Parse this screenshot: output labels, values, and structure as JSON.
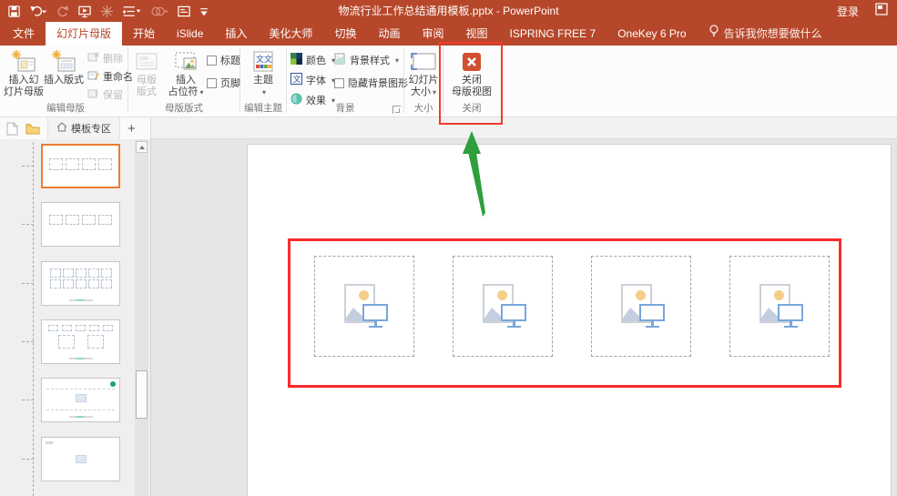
{
  "titlebar": {
    "title": "物流行业工作总结通用模板.pptx - PowerPoint",
    "login": "登录",
    "qat_icons": [
      "save-icon",
      "undo-icon",
      "redo-icon",
      "present-icon",
      "beautify-icon",
      "paragraph-icon",
      "shapes-icon",
      "new-doc-icon",
      "customize-qat-icon"
    ]
  },
  "tabs": [
    {
      "label": "文件"
    },
    {
      "label": "幻灯片母版",
      "active": true
    },
    {
      "label": "开始"
    },
    {
      "label": "iSlide"
    },
    {
      "label": "插入"
    },
    {
      "label": "美化大师"
    },
    {
      "label": "切换"
    },
    {
      "label": "动画"
    },
    {
      "label": "审阅"
    },
    {
      "label": "视图"
    },
    {
      "label": "ISPRING FREE 7"
    },
    {
      "label": "OneKey 6 Pro"
    }
  ],
  "tell_me": "告诉我你想要做什么",
  "ribbon": {
    "edit_master": {
      "label": "编辑母版",
      "insert_master_l1": "插入幻",
      "insert_master_l2": "灯片母版",
      "insert_layout": "插入版式",
      "delete": "删除",
      "rename": "重命名",
      "preserve": "保留"
    },
    "master_layout": {
      "label": "母版版式",
      "master_layout_l1": "母版",
      "master_layout_l2": "版式",
      "insert_placeholder_l1": "插入",
      "insert_placeholder_l2": "占位符",
      "title_cb": "标题",
      "footer_cb": "页脚"
    },
    "edit_theme": {
      "label": "编辑主题",
      "themes": "主题"
    },
    "background": {
      "label": "背景",
      "colors": "颜色",
      "fonts": "字体",
      "effects": "效果",
      "bg_styles": "背景样式",
      "hide_bg": "隐藏背景图形"
    },
    "size": {
      "label": "大小",
      "slide_size_l1": "幻灯片",
      "slide_size_l2": "大小"
    },
    "close": {
      "label": "关闭",
      "close_l1": "关闭",
      "close_l2": "母版视图"
    }
  },
  "panel": {
    "template_tab": "模板专区"
  },
  "thumbnails": [
    {
      "selected": true,
      "layout": "four-picture-placeholders"
    },
    {
      "selected": false,
      "layout": "four-pictures-with-captions"
    },
    {
      "selected": false,
      "layout": "ten-picture-grid"
    },
    {
      "selected": false,
      "layout": "five-plus-two-pictures"
    },
    {
      "selected": false,
      "layout": "lined-content-with-picture"
    },
    {
      "selected": false,
      "layout": "single-picture"
    }
  ],
  "main_slide": {
    "picture_placeholder_count": 4
  },
  "annotations": {
    "highlight_color": "#fb2b2b",
    "arrow_color": "#2f9e3d",
    "highlighted_button": "关闭母版视图",
    "highlighted_region": "4 个图片占位符"
  },
  "colors": {
    "accent": "#b7472a",
    "selection": "#ed7d31"
  }
}
